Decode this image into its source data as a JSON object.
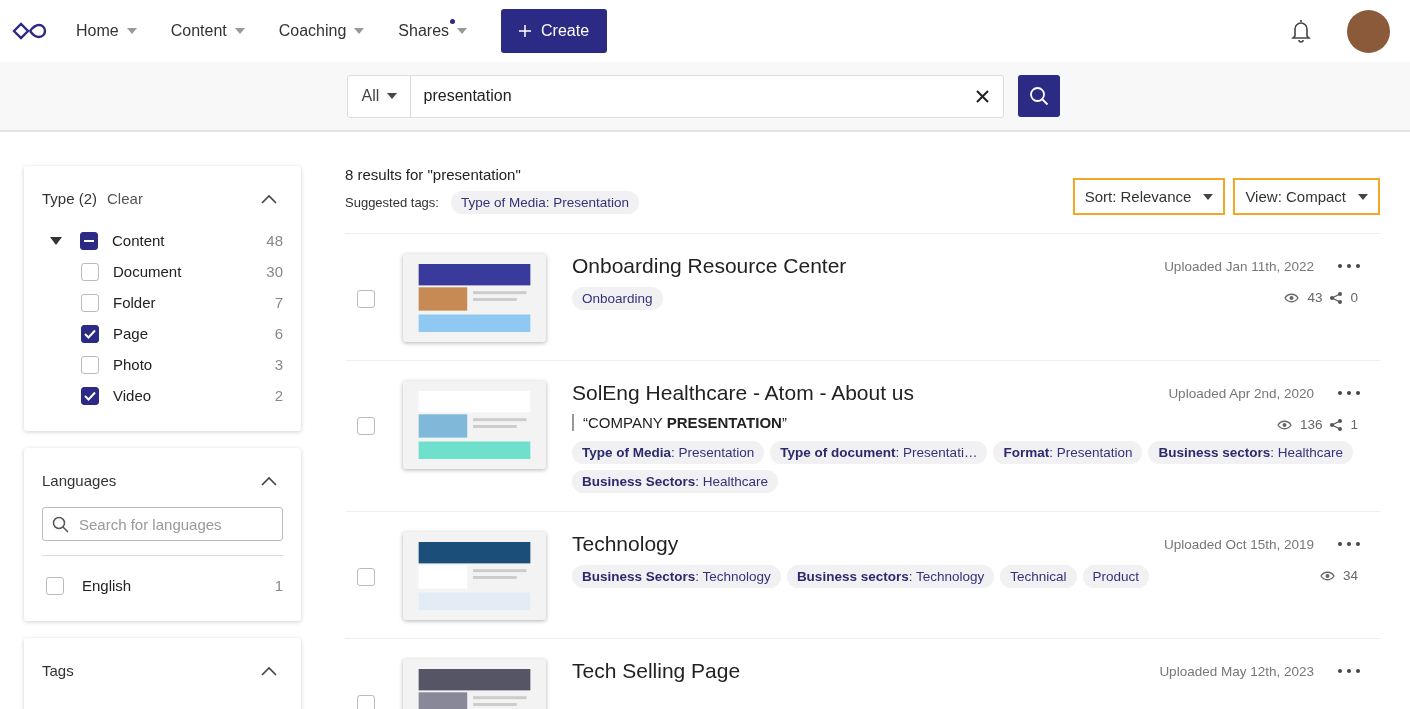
{
  "nav": {
    "items": [
      {
        "label": "Home",
        "dot": false
      },
      {
        "label": "Content",
        "dot": false
      },
      {
        "label": "Coaching",
        "dot": false
      },
      {
        "label": "Shares",
        "dot": true
      }
    ],
    "create": "Create"
  },
  "search": {
    "scope": "All",
    "value": "presentation"
  },
  "filters": {
    "type": {
      "title": "Type (2)",
      "clear": "Clear",
      "expanded": true,
      "root": {
        "label": "Content",
        "checked": true,
        "partial": true,
        "count": "48",
        "expanded": true,
        "children": [
          {
            "label": "Document",
            "checked": false,
            "count": "30"
          },
          {
            "label": "Folder",
            "checked": false,
            "count": "7"
          },
          {
            "label": "Page",
            "checked": true,
            "count": "6"
          },
          {
            "label": "Photo",
            "checked": false,
            "count": "3"
          },
          {
            "label": "Video",
            "checked": true,
            "count": "2"
          }
        ]
      }
    },
    "languages": {
      "title": "Languages",
      "expanded": true,
      "placeholder": "Search for languages",
      "items": [
        {
          "label": "English",
          "checked": false,
          "count": "1"
        }
      ]
    },
    "tags": {
      "title": "Tags",
      "expanded": true
    }
  },
  "results": {
    "summary": "8 results for \"presentation\"",
    "suggested_label": "Suggested tags:",
    "suggested": [
      "Type of Media: Presentation"
    ],
    "sort": "Sort: Relevance",
    "view": "View: Compact",
    "items": [
      {
        "title": "Onboarding Resource Center",
        "uploaded": "Uploaded Jan 11th, 2022",
        "checked": false,
        "views": "43",
        "shares": "0",
        "tags": [
          "Onboarding"
        ]
      },
      {
        "title": "SolEng Healthcare - Atom - About us",
        "uploaded": "Uploaded Apr 2nd, 2020",
        "checked": false,
        "quote": "“COMPANY **PRESENTATION**”",
        "views": "136",
        "shares": "1",
        "tags": [
          "**Type of Media**: Presentation",
          "**Type of document**: Presentati…",
          "**Format**: Presentation",
          "**Business sectors**: Healthcare",
          "**Business Sectors**: Healthcare"
        ]
      },
      {
        "title": "Technology",
        "uploaded": "Uploaded Oct 15th, 2019",
        "checked": false,
        "views": "34",
        "tags": [
          "**Business Sectors**: Technology",
          "**Business sectors**: Technology",
          "Technical",
          "Product"
        ]
      },
      {
        "title": "Tech Selling Page",
        "uploaded": "Uploaded May 12th, 2023",
        "checked": false
      }
    ]
  }
}
